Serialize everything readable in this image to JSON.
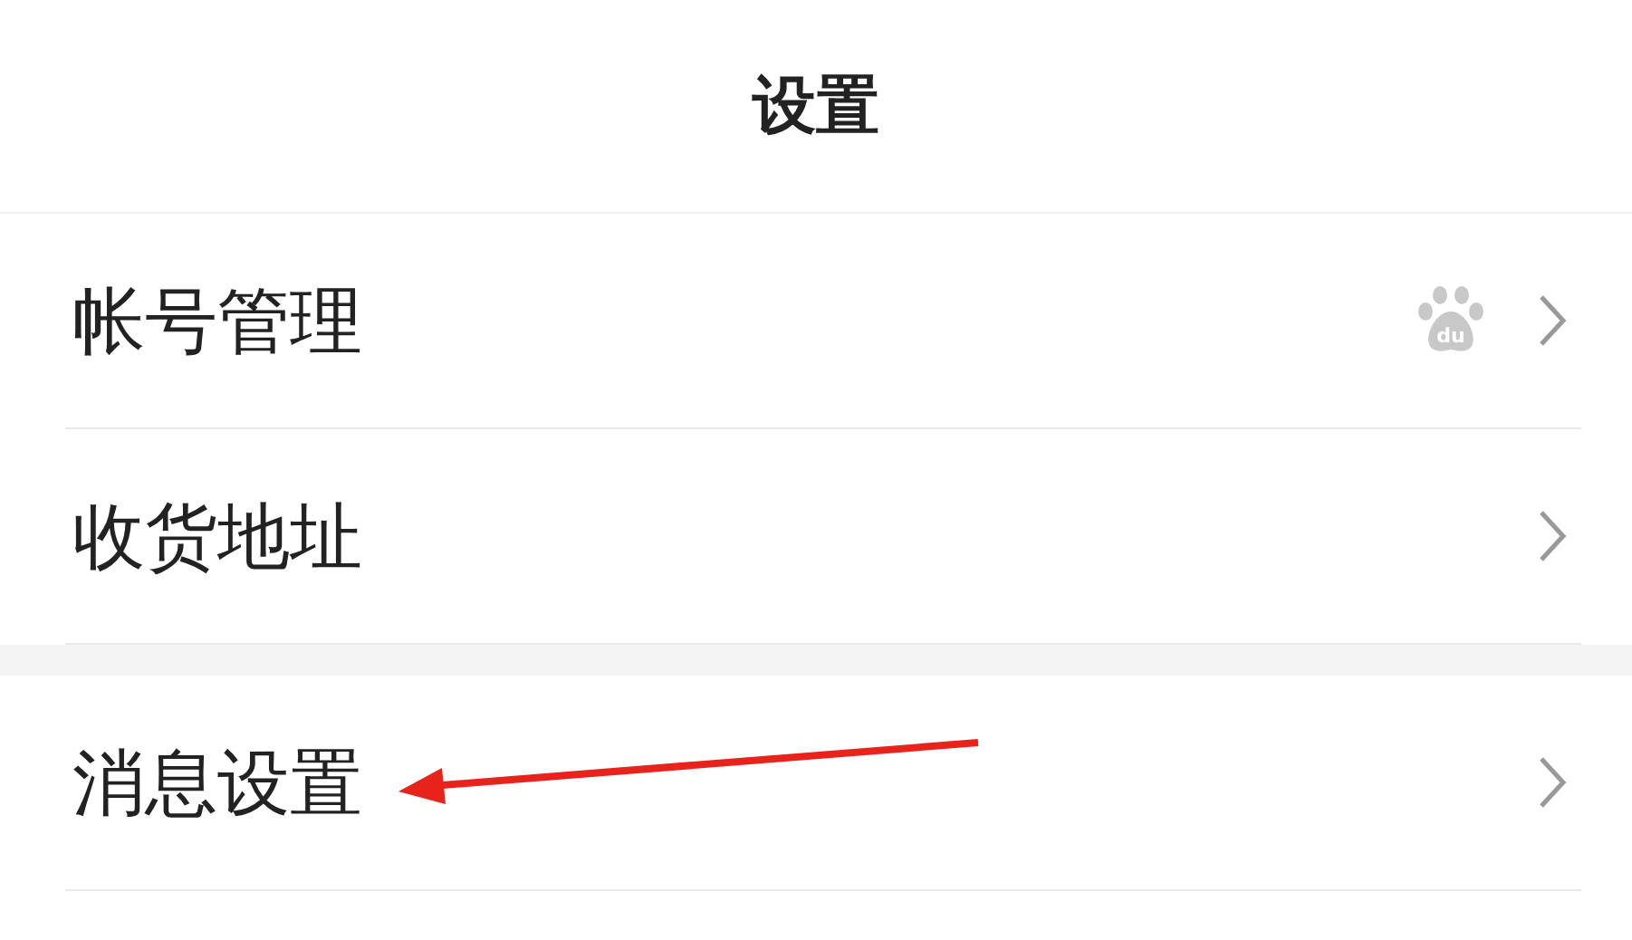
{
  "header": {
    "title": "设置"
  },
  "groups": [
    {
      "items": [
        {
          "label": "帐号管理",
          "kind": "account",
          "badge_text": "du"
        },
        {
          "label": "收货地址",
          "kind": "plain"
        }
      ]
    },
    {
      "items": [
        {
          "label": "消息设置",
          "kind": "plain"
        }
      ]
    }
  ],
  "annotation": {
    "kind": "arrow"
  }
}
